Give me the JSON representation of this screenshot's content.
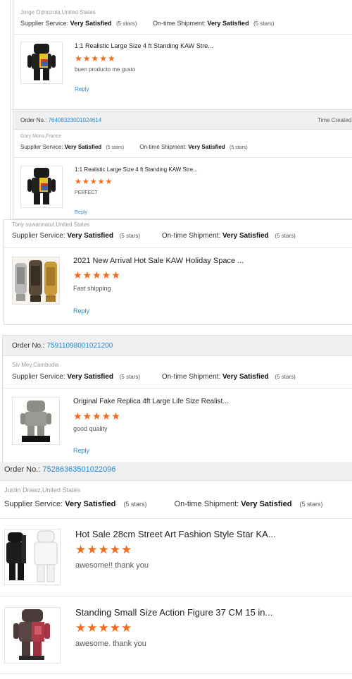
{
  "labels": {
    "supplier_service": "Supplier Service:",
    "ontime_shipment": "On-time Shipment:",
    "order_no": "Order No.:",
    "time_created": "Time Created",
    "reply": "Reply",
    "star_glyphs": "★★★★★"
  },
  "reviews": [
    {
      "buyer": "Jorge Odriozola,United States",
      "supplier_rating": "Very Satisfied",
      "supplier_stars": "(5 stars)",
      "shipment_rating": "Very Satisfied",
      "shipment_stars": "(5 stars)",
      "product_title": "1:1 Realistic Large Size 4 ft Standing KAW Stre...",
      "stars": 5,
      "comment": "buen producto me gusto"
    },
    {
      "order_no": "76408323001024614",
      "buyer": "Gary Mons,France",
      "supplier_rating": "Very Satisfied",
      "supplier_stars": "(5 stars)",
      "shipment_rating": "Very Satisfied",
      "shipment_stars": "(5 stars)",
      "product_title": "1:1 Realistic Large Size 4 ft Standing KAW Stre...",
      "stars": 5,
      "comment": "PERFECT"
    },
    {
      "buyer": "Tony suwannatut,United States",
      "supplier_rating": "Very Satisfied",
      "supplier_stars": "(5 stars)",
      "shipment_rating": "Very Satisfied",
      "shipment_stars": "(5 stars)",
      "product_title": "2021 New Arrival Hot Sale KAW Holiday Space ...",
      "stars": 5,
      "comment": "Fast shipping"
    },
    {
      "order_no": "75911098001021200",
      "buyer": "Siv Mey,Cambodia",
      "supplier_rating": "Very Satisfied",
      "supplier_stars": "(5 stars)",
      "shipment_rating": "Very Satisfied",
      "shipment_stars": "(5 stars)",
      "product_title": "Original Fake Replica 4ft Large Life Size Realist...",
      "stars": 5,
      "comment": "good quality"
    },
    {
      "order_no": "75286363501022096",
      "buyer": "Justin Drawz,United States",
      "supplier_rating": "Very Satisfied",
      "supplier_stars": "(5 stars)",
      "shipment_rating": "Very Satisfied",
      "shipment_stars": "(5 stars)",
      "products": [
        {
          "product_title": "Hot Sale 28cm Street Art Fashion Style Star KA...",
          "stars": 5,
          "comment": "awesome!! thank you"
        },
        {
          "product_title": "Standing Small Size Action Figure 37 CM 15 in...",
          "stars": 5,
          "comment": "awesome. thank you"
        }
      ]
    }
  ],
  "colors": {
    "link": "#1c8bd6",
    "star": "#f26a1b",
    "header_bg": "#f0f0f0",
    "border": "#dcdcdc"
  }
}
